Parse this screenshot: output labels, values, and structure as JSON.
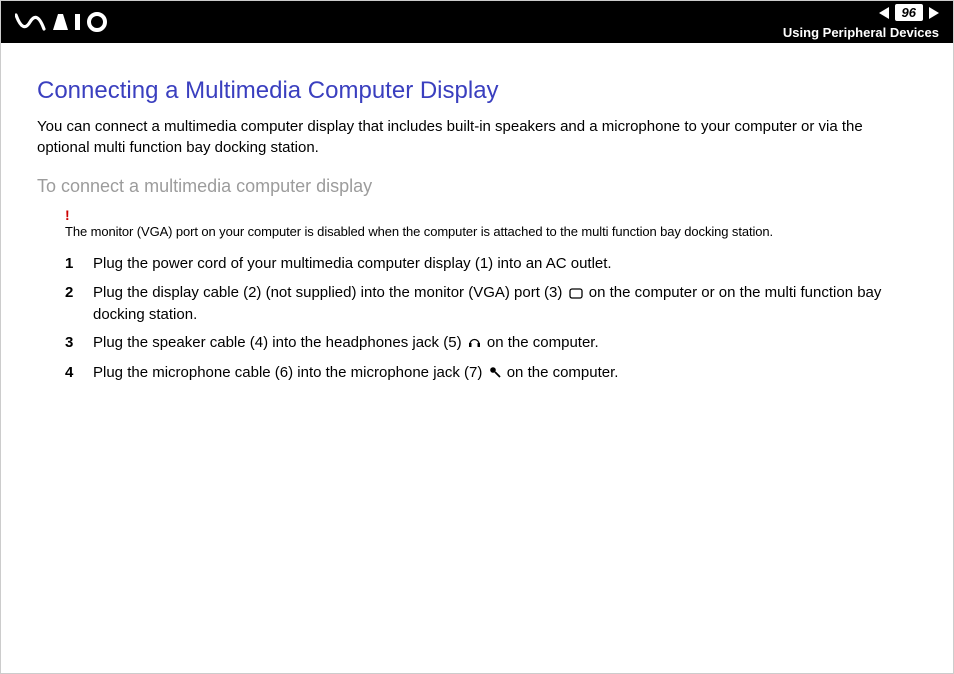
{
  "header": {
    "page_number": "96",
    "section_title": "Using Peripheral Devices"
  },
  "main": {
    "heading": "Connecting a Multimedia Computer Display",
    "intro": "You can connect a multimedia computer display that includes built-in speakers and a microphone to your computer or via the optional multi function bay docking station.",
    "subheading": "To connect a multimedia computer display",
    "warning": "The monitor (VGA) port on your computer is disabled when the computer is attached to the multi function bay docking station.",
    "steps": [
      {
        "n": "1",
        "text": "Plug the power cord of your multimedia computer display (1) into an AC outlet."
      },
      {
        "n": "2",
        "text_a": "Plug the display cable (2) (not supplied) into the monitor (VGA) port (3) ",
        "text_b": " on the computer or on the multi function bay docking station."
      },
      {
        "n": "3",
        "text_a": "Plug the speaker cable (4) into the headphones jack (5) ",
        "text_b": " on the computer."
      },
      {
        "n": "4",
        "text_a": "Plug the microphone cable (6) into the microphone jack (7) ",
        "text_b": " on the computer."
      }
    ]
  }
}
